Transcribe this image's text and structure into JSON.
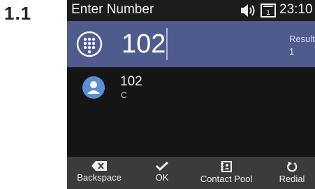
{
  "step_label": "1.1",
  "status_bar": {
    "title": "Enter Number",
    "time": "23:10",
    "line_indicator": "1"
  },
  "input": {
    "value": "102",
    "result_label": "Result",
    "result_count": "1"
  },
  "results": [
    {
      "number": "102",
      "subtitle": "C",
      "icon": "contact-avatar-icon"
    }
  ],
  "softkeys": [
    {
      "label": "Backspace",
      "icon": "backspace-icon"
    },
    {
      "label": "OK",
      "icon": "checkmark-icon"
    },
    {
      "label": "Contact Pool",
      "icon": "contact-book-icon"
    },
    {
      "label": "Redial",
      "icon": "redial-icon"
    }
  ],
  "colors": {
    "input_bar": "#4f5b8c",
    "screen_background": "#151515",
    "softkey_bar": "#3b3b3b",
    "avatar": "#5b8fd4"
  }
}
